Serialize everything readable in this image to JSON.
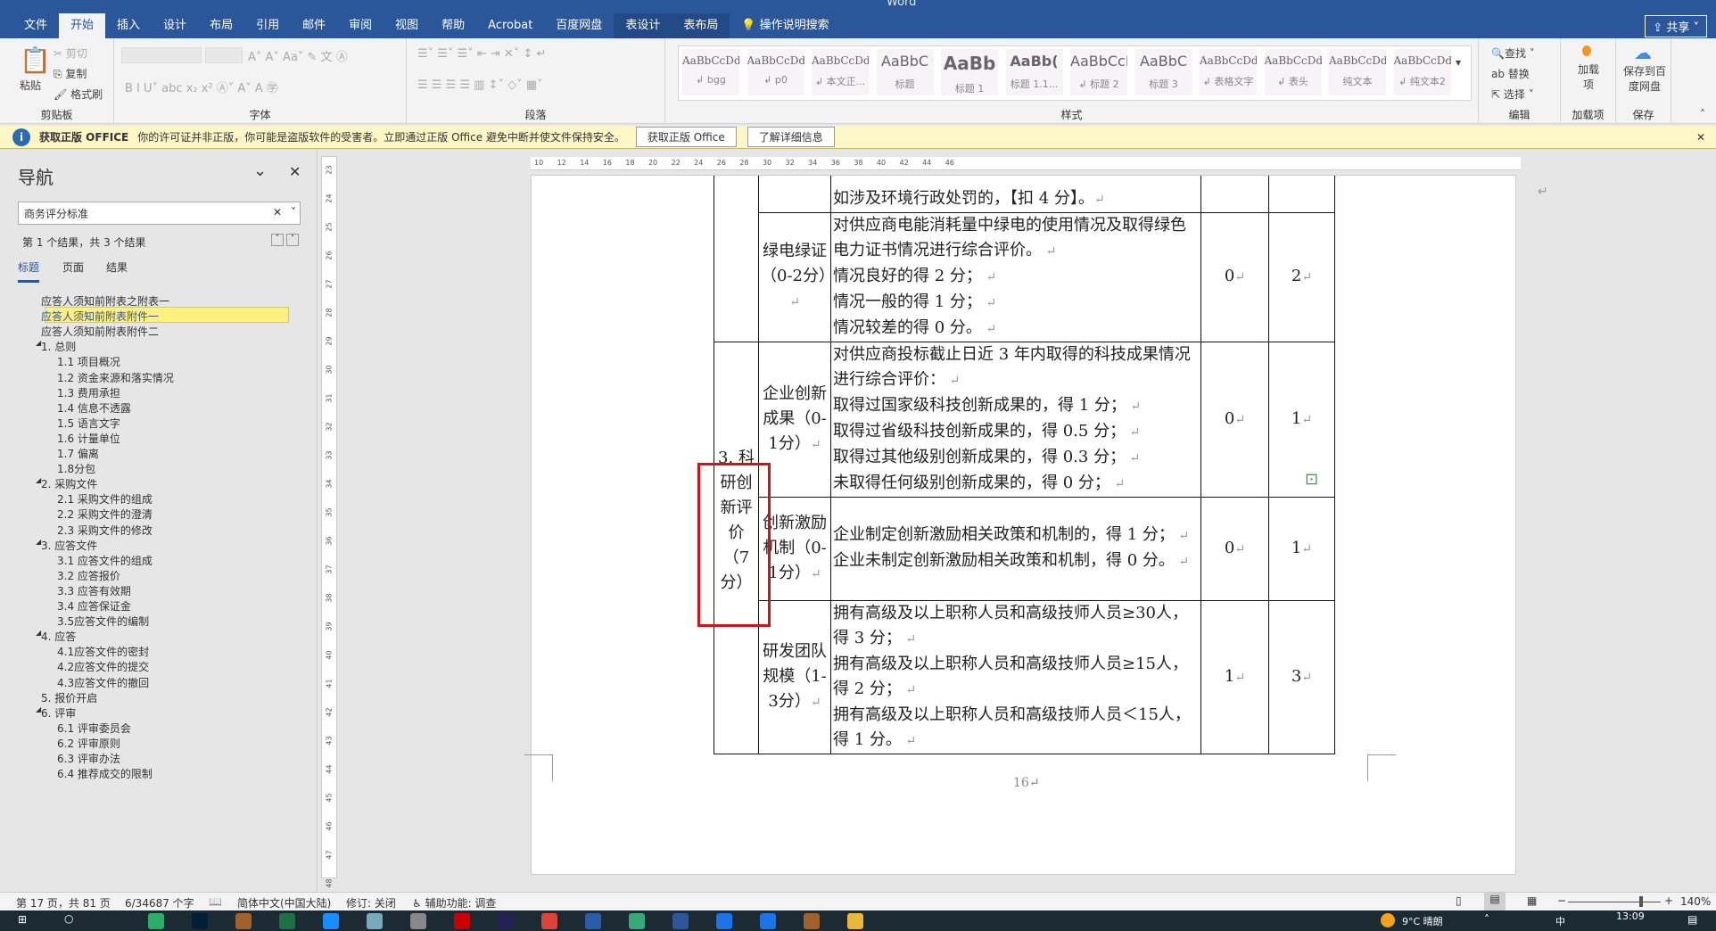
{
  "window": {
    "app": "Word"
  },
  "tabs": [
    "文件",
    "开始",
    "插入",
    "设计",
    "布局",
    "引用",
    "邮件",
    "审阅",
    "视图",
    "帮助",
    "Acrobat",
    "百度网盘",
    "表设计",
    "表布局"
  ],
  "tell_me": "操作说明搜索",
  "share": "共享",
  "ribbon": {
    "clipboard": {
      "paste": "粘贴",
      "cut": "剪切",
      "copy": "复制",
      "format_painter": "格式刷",
      "label": "剪贴板"
    },
    "font": {
      "label": "字体"
    },
    "paragraph": {
      "label": "段落"
    },
    "styles": {
      "label": "样式",
      "items": [
        {
          "preview": "AaBbCcDdI",
          "name": "↲ bgg"
        },
        {
          "preview": "AaBbCcDd",
          "name": "↲ p0"
        },
        {
          "preview": "AaBbCcDd",
          "name": "↲ 本文正..."
        },
        {
          "preview": "AaBbC",
          "name": "标题"
        },
        {
          "preview": "AaBb",
          "name": "标题 1"
        },
        {
          "preview": "AaBb(",
          "name": "标题 1.1..."
        },
        {
          "preview": "AaBbCcI",
          "name": "↲ 标题 2"
        },
        {
          "preview": "AaBbC",
          "name": "标题 3"
        },
        {
          "preview": "AaBbCcDd",
          "name": "↲ 表格文字"
        },
        {
          "preview": "AaBbCcDdI",
          "name": "↲ 表头"
        },
        {
          "preview": "AaBbCcDdI",
          "name": "纯文本"
        },
        {
          "preview": "AaBbCcDdI",
          "name": "↲ 纯文本2"
        }
      ]
    },
    "editing": {
      "find": "查找",
      "replace": "替换",
      "select": "选择",
      "label": "编辑"
    },
    "addins": {
      "button": "加载项",
      "label": "加载项"
    },
    "save": {
      "button": "保存到百度网盘",
      "label": "保存"
    }
  },
  "notice": {
    "title": "获取正版 OFFICE",
    "message": "你的许可证并非正版，你可能是盗版软件的受害者。立即通过正版 Office 避免中断并使文件保持安全。",
    "btn1": "获取正版 Office",
    "btn2": "了解详细信息"
  },
  "nav": {
    "title": "导航",
    "search": "商务评分标准",
    "result": "第 1 个结果，共 3 个结果",
    "tabs": [
      "标题",
      "页面",
      "结果"
    ],
    "items": [
      {
        "t": "应答人须知前附表之附表一",
        "l": 1
      },
      {
        "t": "应答人须知前附表附件一",
        "l": 1,
        "sel": true
      },
      {
        "t": "应答人须知前附表附件二",
        "l": 1
      },
      {
        "t": "1. 总则",
        "l": 1,
        "exp": true
      },
      {
        "t": "1.1 项目概况",
        "l": 2
      },
      {
        "t": "1.2 资金来源和落实情况",
        "l": 2
      },
      {
        "t": "1.3 费用承担",
        "l": 2
      },
      {
        "t": "1.4 信息不透露",
        "l": 2
      },
      {
        "t": "1.5 语言文字",
        "l": 2
      },
      {
        "t": "1.6 计量单位",
        "l": 2
      },
      {
        "t": "1.7 偏离",
        "l": 2
      },
      {
        "t": "1.8分包",
        "l": 2
      },
      {
        "t": "2. 采购文件",
        "l": 1,
        "exp": true
      },
      {
        "t": "2.1 采购文件的组成",
        "l": 2
      },
      {
        "t": "2.2 采购文件的澄清",
        "l": 2
      },
      {
        "t": "2.3 采购文件的修改",
        "l": 2
      },
      {
        "t": "3. 应答文件",
        "l": 1,
        "exp": true
      },
      {
        "t": "3.1 应答文件的组成",
        "l": 2
      },
      {
        "t": "3.2 应答报价",
        "l": 2
      },
      {
        "t": "3.3 应答有效期",
        "l": 2
      },
      {
        "t": "3.4 应答保证金",
        "l": 2
      },
      {
        "t": "3.5应答文件的编制",
        "l": 2
      },
      {
        "t": "4. 应答",
        "l": 1,
        "exp": true
      },
      {
        "t": "4.1应答文件的密封",
        "l": 2
      },
      {
        "t": "4.2应答文件的提交",
        "l": 2
      },
      {
        "t": "4.3应答文件的撤回",
        "l": 2
      },
      {
        "t": "5. 报价开启",
        "l": 1
      },
      {
        "t": "6. 评审",
        "l": 1,
        "exp": true
      },
      {
        "t": "6.1 评审委员会",
        "l": 2
      },
      {
        "t": "6.2 评审原则",
        "l": 2
      },
      {
        "t": "6.3 评审办法",
        "l": 2
      },
      {
        "t": "6.4 推荐成交的限制",
        "l": 2
      }
    ]
  },
  "table": {
    "row0": "如涉及环境行政处罚的，【扣 4 分】。",
    "category": "3. 科研创新评价（7分）",
    "rows": [
      {
        "name": "绿电绿证（0-2分）",
        "desc": [
          "对供应商电能消耗量中绿电的使用情况及取得绿色电力证书情况进行综合评价。",
          "情况良好的得 2 分；",
          "情况一般的得 1 分；",
          "情况较差的得 0 分。"
        ],
        "min": "0",
        "max": "2"
      },
      {
        "name": "企业创新成果（0-1分）",
        "desc": [
          "对供应商投标截止日近 3 年内取得的科技成果情况进行综合评价：",
          "取得过国家级科技创新成果的，得 1 分；",
          "取得过省级科技创新成果的，得 0.5 分；",
          "取得过其他级别创新成果的，得 0.3 分；",
          "未取得任何级别创新成果的，得 0 分；"
        ],
        "min": "0",
        "max": "1"
      },
      {
        "name": "创新激励机制（0-1分）",
        "desc": [
          "企业制定创新激励相关政策和机制的，得 1 分；",
          "企业未制定创新激励相关政策和机制，得 0 分。"
        ],
        "min": "0",
        "max": "1"
      },
      {
        "name": "研发团队规模（1-3分）",
        "desc": [
          "拥有高级及以上职称人员和高级技师人员≥30人，得 3 分；",
          "拥有高级及以上职称人员和高级技师人员≥15人，得 2 分；",
          "拥有高级及以上职称人员和高级技师人员＜15人，得 1 分。"
        ],
        "min": "1",
        "max": "3"
      }
    ],
    "page_number": "16"
  },
  "status": {
    "page": "第 17 页，共 81 页",
    "words": "6/34687 个字",
    "lang": "简体中文(中国大陆)",
    "track": "修订: 关闭",
    "access": "辅助功能: 调查",
    "zoom": "140%",
    "zoom_value": 140
  },
  "taskbar": {
    "weather": "9°C 晴朗",
    "time": "13:09",
    "ime": "中"
  },
  "colors": {
    "accent": "#2b579a",
    "highlight": "#fff080",
    "redbox": "#d0121b"
  }
}
